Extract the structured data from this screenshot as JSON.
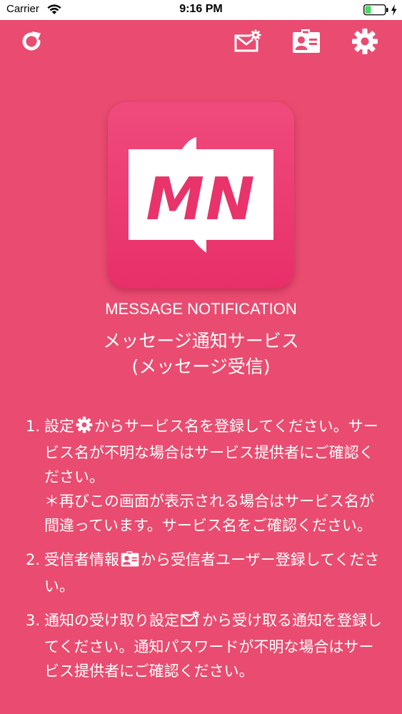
{
  "status_bar": {
    "carrier": "Carrier",
    "time": "9:16 PM",
    "battery_level": 0.3
  },
  "toolbar": {
    "refresh_icon": "refresh-icon",
    "notification_settings_icon": "mail-gear-icon",
    "receiver_info_icon": "contact-card-icon",
    "settings_icon": "gear-icon"
  },
  "brand": {
    "logo_text": "MN",
    "app_name_en": "MESSAGE NOTIFICATION",
    "app_name_ja_line1": "メッセージ通知サービス",
    "app_name_ja_line2": "(メッセージ受信)"
  },
  "instructions": [
    {
      "number": "1.",
      "before_icon": "設定",
      "icon": "gear-icon",
      "after_icon": "からサービス名を登録してください。サービス名が不明な場合はサービス提供者にご確認ください。",
      "note": "＊再びこの画面が表示される場合はサービス名が間違っています。サービス名をご確認ください。"
    },
    {
      "number": "2.",
      "before_icon": "受信者情報",
      "icon": "contact-card-icon",
      "after_icon": "から受信者ユーザー登録してください。"
    },
    {
      "number": "3.",
      "before_icon": "通知の受け取り設定",
      "icon": "mail-gear-icon",
      "after_icon": "から受け取る通知を登録してください。通知パスワードが不明な場合はサービス提供者にご確認ください。"
    }
  ],
  "colors": {
    "background": "#e94c70",
    "logo_gradient_top": "#f04b7d",
    "logo_gradient_bottom": "#e82f6a",
    "text": "#ffffff",
    "battery_fill": "#4cd964"
  }
}
